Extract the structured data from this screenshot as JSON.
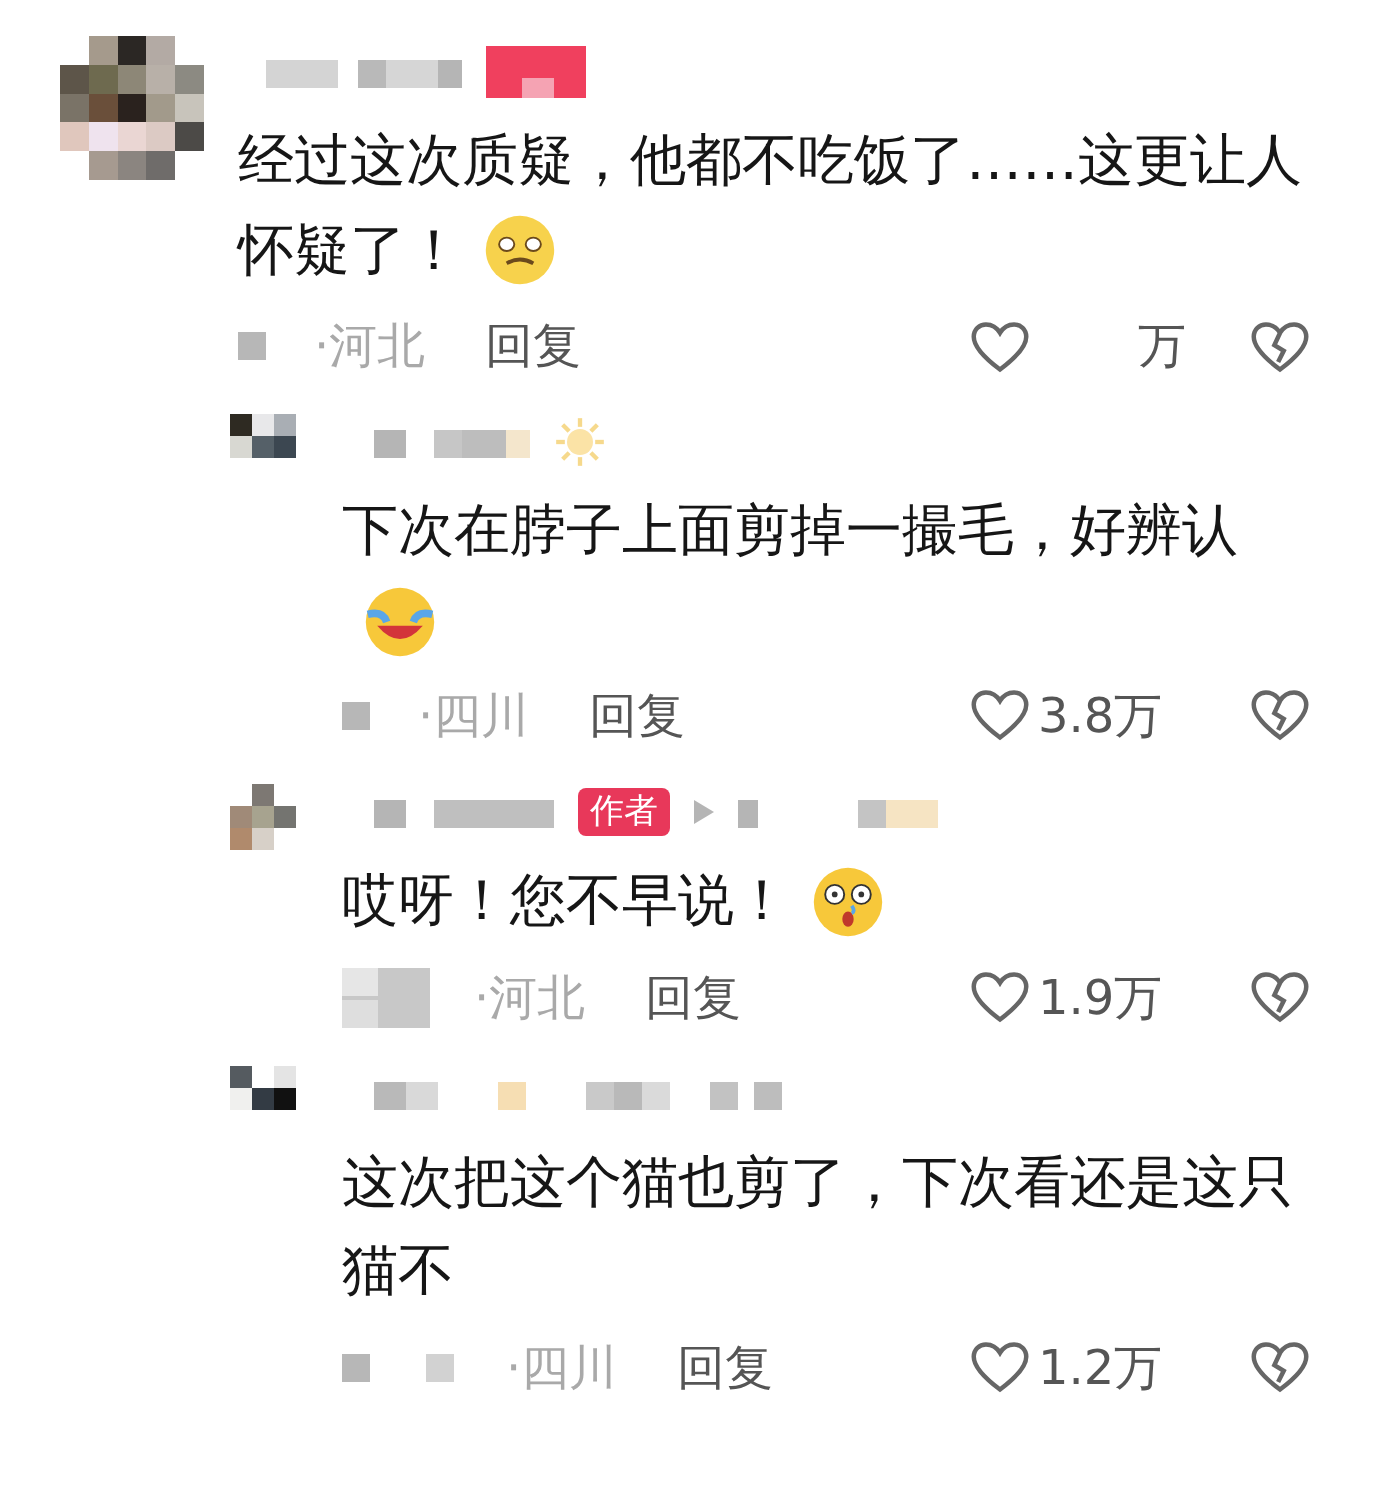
{
  "comments": [
    {
      "kind": "comment",
      "text": "经过这次质疑，他都不吃饭了……这更让人怀疑了！",
      "emoji": true,
      "location": "·河北",
      "reply": "回复",
      "likes": "万"
    },
    {
      "kind": "reply",
      "text": "下次在脖子上面剪掉一撮毛，好辨认",
      "emoji": true,
      "location": "·四川",
      "reply": "回复",
      "likes": "3.8万"
    },
    {
      "kind": "reply",
      "text": "哎呀！您不早说！",
      "emoji": true,
      "badge": "作者",
      "location": "·河北",
      "reply": "回复",
      "likes": "1.9万"
    },
    {
      "kind": "reply",
      "text": "这次把这个猫也剪了，下次看还是这只猫不",
      "emoji": false,
      "location": "·四川",
      "reply": "回复",
      "likes": "1.2万"
    }
  ]
}
